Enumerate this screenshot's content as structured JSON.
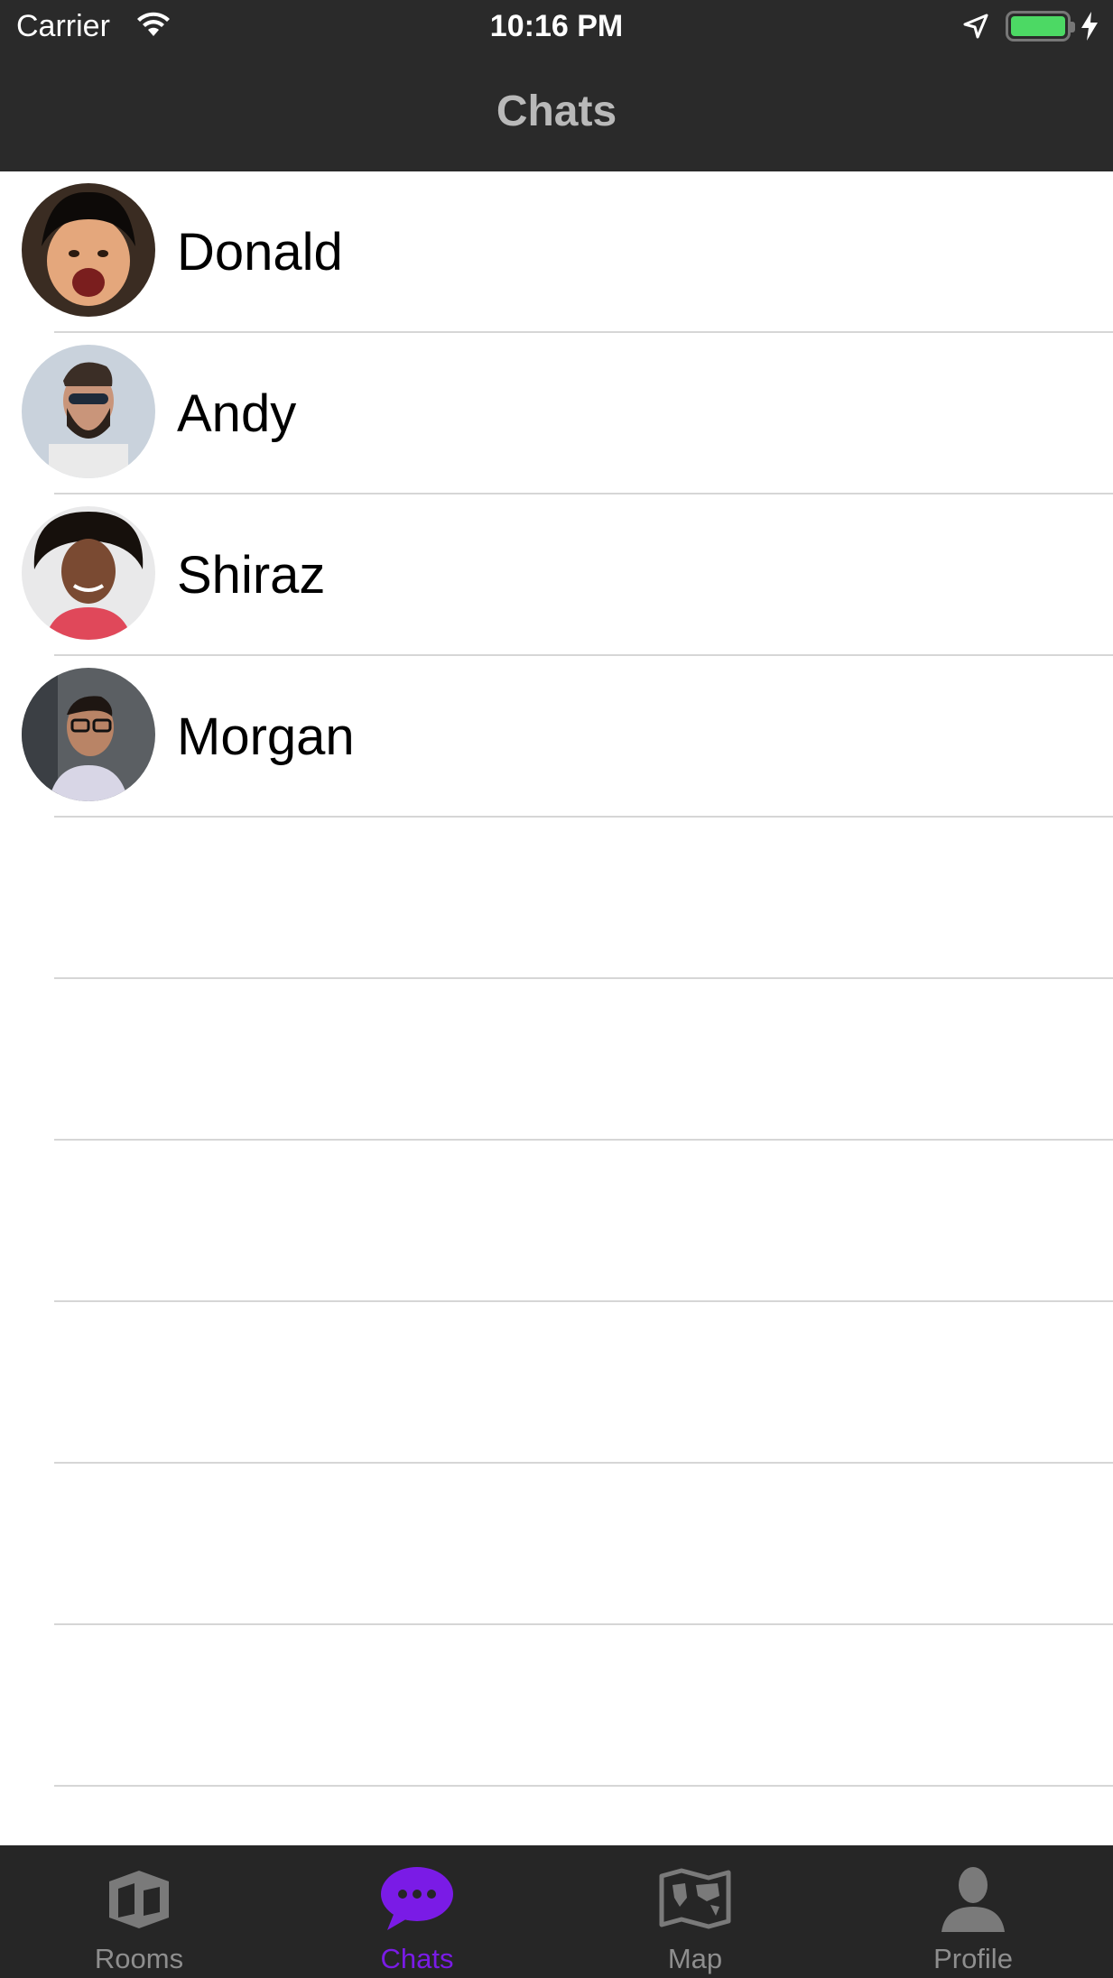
{
  "status_bar": {
    "carrier": "Carrier",
    "time": "10:16 PM",
    "battery_color": "#4cd964"
  },
  "nav": {
    "title": "Chats"
  },
  "chats": [
    {
      "name": "Donald",
      "avatar": "avatar-donald"
    },
    {
      "name": "Andy",
      "avatar": "avatar-andy"
    },
    {
      "name": "Shiraz",
      "avatar": "avatar-shiraz"
    },
    {
      "name": "Morgan",
      "avatar": "avatar-morgan"
    }
  ],
  "tabs": [
    {
      "label": "Rooms",
      "icon": "rooms-icon"
    },
    {
      "label": "Chats",
      "icon": "chat-bubble-icon",
      "active": true
    },
    {
      "label": "Map",
      "icon": "map-icon"
    },
    {
      "label": "Profile",
      "icon": "profile-icon"
    }
  ],
  "colors": {
    "accent": "#7a1be6",
    "bar": "#262626",
    "inactive": "#8e8e8e"
  }
}
